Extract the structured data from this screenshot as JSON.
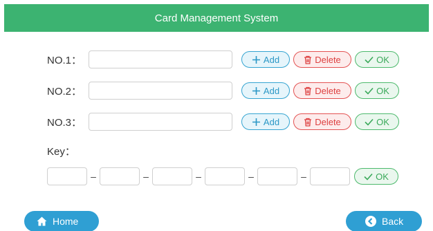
{
  "header": {
    "title": "Card Management System"
  },
  "cards": [
    {
      "label": "NO.1：",
      "value": ""
    },
    {
      "label": "NO.2：",
      "value": ""
    },
    {
      "label": "NO.3：",
      "value": ""
    }
  ],
  "buttons": {
    "add": "Add",
    "delete": "Delete",
    "ok": "OK"
  },
  "key": {
    "label": "Key：",
    "separator": "–",
    "segments": [
      "",
      "",
      "",
      "",
      "",
      ""
    ]
  },
  "nav": {
    "home": "Home",
    "back": "Back"
  },
  "colors": {
    "header_bg": "#3cb371",
    "add": "#2a97c6",
    "delete": "#dd3f3f",
    "ok": "#3aa95a",
    "nav": "#2f9fd3"
  },
  "icons": {
    "add": "plus-icon",
    "delete": "trash-icon",
    "ok": "check-icon",
    "home": "home-icon",
    "back": "back-arrow-icon"
  }
}
